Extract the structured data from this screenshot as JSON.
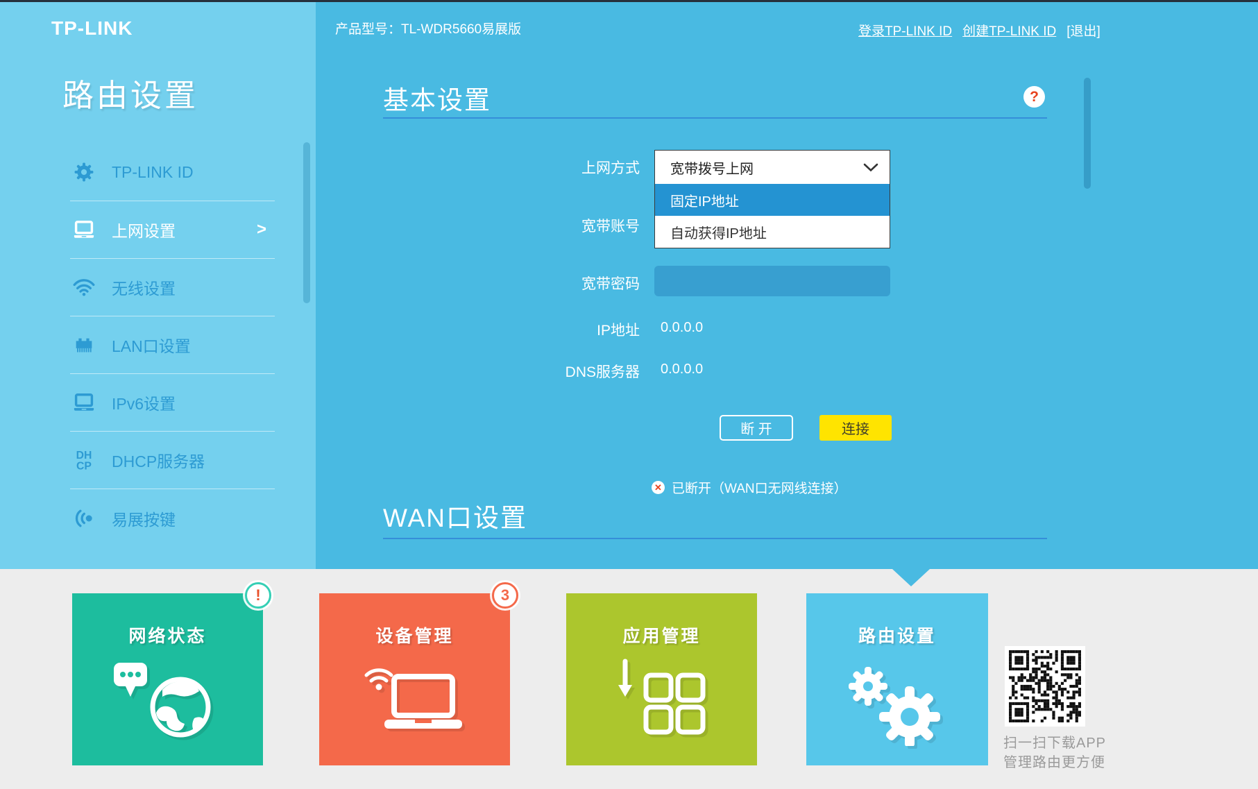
{
  "colors": {
    "page_blue": "#49bae2",
    "sidebar_blue": "#74d0ee",
    "sidebar_link": "#2d9bd3",
    "top_strip": "#26303c",
    "heading_underline": "#2f7fd6",
    "dropdown_highlight": "#2493d2",
    "field_blue": "#389fd0",
    "connect_yellow": "#ffe400",
    "alert_red": "#e8431f",
    "band_gray": "#ededed",
    "caption_gray": "#9a9a9a"
  },
  "topbar": {
    "product_label": "产品型号：TL-WDR5660易展版",
    "links": [
      {
        "label": "登录TP-LINK ID"
      },
      {
        "label": "创建TP-LINK ID"
      },
      {
        "label": "[退出]"
      }
    ]
  },
  "sidebar": {
    "logo": "TP-LINK",
    "title": "路由设置",
    "items": [
      {
        "label": "TP-LINK ID",
        "icon": "gear-icon",
        "active": false
      },
      {
        "label": "上网设置",
        "icon": "laptop-icon",
        "active": true,
        "arrow": ">"
      },
      {
        "label": "无线设置",
        "icon": "wifi-icon",
        "active": false
      },
      {
        "label": "LAN口设置",
        "icon": "lan-port-icon",
        "active": false
      },
      {
        "label": "IPv6设置",
        "icon": "laptop-icon",
        "active": false
      },
      {
        "label": "DHCP服务器",
        "icon": "dhcp-icon",
        "active": false
      },
      {
        "label": "易展按键",
        "icon": "mesh-icon",
        "active": false
      }
    ]
  },
  "main": {
    "basic_title": "基本设置",
    "help_glyph": "?",
    "wan_title": "WAN口设置",
    "form": {
      "mode_label": "上网方式",
      "mode_value": "宽带拨号上网",
      "options": [
        {
          "label": "固定IP地址",
          "highlighted": true
        },
        {
          "label": "自动获得IP地址",
          "highlighted": false
        }
      ],
      "account_label": "宽带账号",
      "password_label": "宽带密码",
      "password_value": "",
      "ip_label": "IP地址",
      "ip_value": "0.0.0.0",
      "dns_label": "DNS服务器",
      "dns_value": "0.0.0.0",
      "disconnect_label": "断 开",
      "connect_label": "连接",
      "status_icon": "✕",
      "status_text": "已断开（WAN口无网线连接）"
    }
  },
  "bottom_nav": {
    "tiles": [
      {
        "label": "网络状态",
        "color": "#1dbd9e",
        "badge": "!",
        "badge_color": "#e8502a",
        "ring_color": "#35cfb5"
      },
      {
        "label": "设备管理",
        "color": "#f4694a",
        "badge": "3",
        "badge_color": "#f4694a",
        "ring_color": "#f4694a"
      },
      {
        "label": "应用管理",
        "color": "#acc62d"
      },
      {
        "label": "路由设置",
        "color": "#57c7ea",
        "active": true
      }
    ],
    "qr_caption_line1": "扫一扫下载APP",
    "qr_caption_line2": "管理路由更方便"
  }
}
